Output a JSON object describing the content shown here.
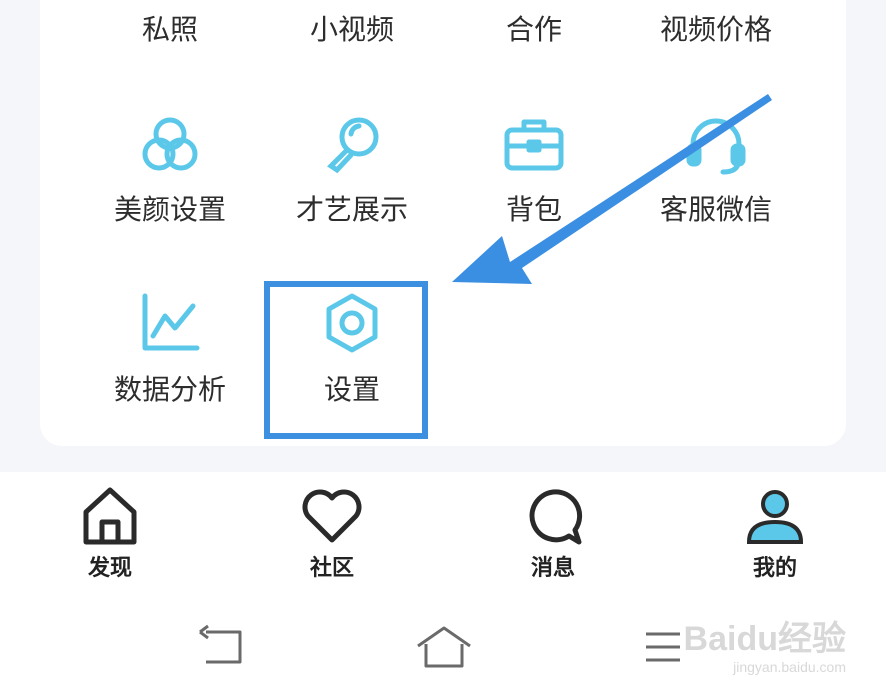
{
  "menu": {
    "row0": [
      "私照",
      "小视频",
      "合作",
      "视频价格"
    ],
    "row1": [
      {
        "label": "美颜设置",
        "icon": "circles-icon"
      },
      {
        "label": "才艺展示",
        "icon": "magnifier-icon"
      },
      {
        "label": "背包",
        "icon": "briefcase-icon"
      },
      {
        "label": "客服微信",
        "icon": "headset-icon"
      }
    ],
    "row2": [
      {
        "label": "数据分析",
        "icon": "line-chart-icon"
      },
      {
        "label": "设置",
        "icon": "hex-nut-icon"
      }
    ]
  },
  "tabbar": [
    {
      "label": "发现",
      "icon": "home-icon"
    },
    {
      "label": "社区",
      "icon": "heart-icon"
    },
    {
      "label": "消息",
      "icon": "chat-bubble-icon"
    },
    {
      "label": "我的",
      "icon": "person-icon"
    }
  ],
  "watermark": {
    "main": "Baidu经验",
    "sub": "jingyan.baidu.com"
  },
  "colors": {
    "icon_accent": "#5bc8ea",
    "highlight": "#3d8fe0",
    "arrow": "#3b8fe2",
    "text": "#2d2d2d"
  }
}
